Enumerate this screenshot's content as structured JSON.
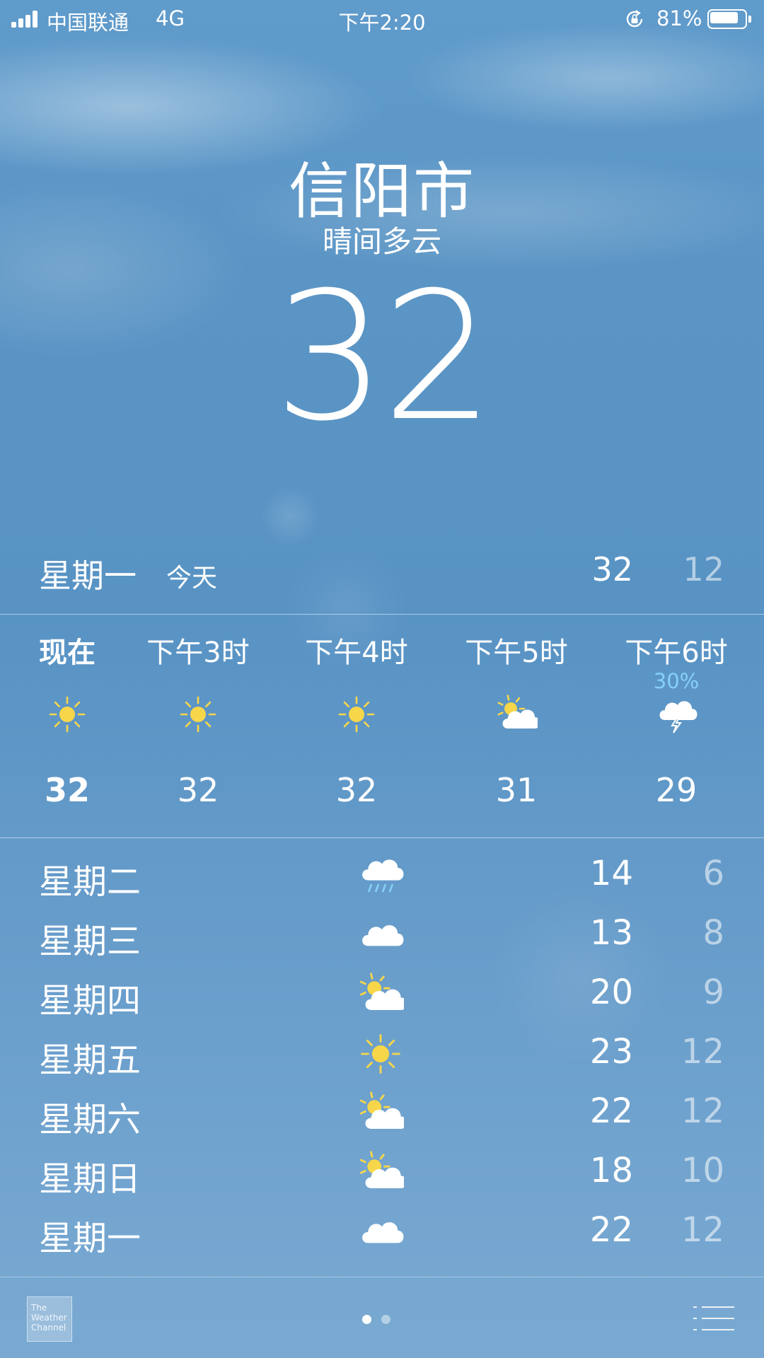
{
  "status_bar": {
    "carrier": "中国联通",
    "network": "4G",
    "time": "下午2:20",
    "battery_percent_text": "81%",
    "battery_level": 0.81
  },
  "location": {
    "city": "信阳市",
    "condition": "晴间多云",
    "current_temp": "32"
  },
  "today": {
    "day": "星期一",
    "tag": "今天",
    "high": "32",
    "low": "12"
  },
  "hourly": [
    {
      "label": "现在",
      "icon": "sun-icon",
      "temp": "32",
      "precip": ""
    },
    {
      "label": "下午3时",
      "icon": "sun-icon",
      "temp": "32",
      "precip": ""
    },
    {
      "label": "下午4时",
      "icon": "sun-icon",
      "temp": "32",
      "precip": ""
    },
    {
      "label": "下午5时",
      "icon": "partly-cloudy-icon",
      "temp": "31",
      "precip": ""
    },
    {
      "label": "下午6时",
      "icon": "thunderstorm-icon",
      "temp": "29",
      "precip": "30%"
    }
  ],
  "daily": [
    {
      "day": "星期二",
      "icon": "rain-icon",
      "high": "14",
      "low": "6"
    },
    {
      "day": "星期三",
      "icon": "cloud-icon",
      "high": "13",
      "low": "8"
    },
    {
      "day": "星期四",
      "icon": "partly-cloudy-icon",
      "high": "20",
      "low": "9"
    },
    {
      "day": "星期五",
      "icon": "sun-icon",
      "high": "23",
      "low": "12"
    },
    {
      "day": "星期六",
      "icon": "partly-cloudy-icon",
      "high": "22",
      "low": "12"
    },
    {
      "day": "星期日",
      "icon": "partly-cloudy-icon",
      "high": "18",
      "low": "10"
    },
    {
      "day": "星期一",
      "icon": "cloud-icon",
      "high": "22",
      "low": "12"
    }
  ],
  "footer": {
    "logo_lines": [
      "The",
      "Weather",
      "Channel"
    ],
    "logo_icon": "weather-channel-logo-icon",
    "page_count": 2,
    "current_page": 1,
    "list_icon": "list-icon"
  },
  "colors": {
    "sun": "#f7d64a",
    "cloud": "#ffffff",
    "precip_text": "#86d0f7",
    "low_temp": "rgba(255,255,255,0.55)"
  }
}
